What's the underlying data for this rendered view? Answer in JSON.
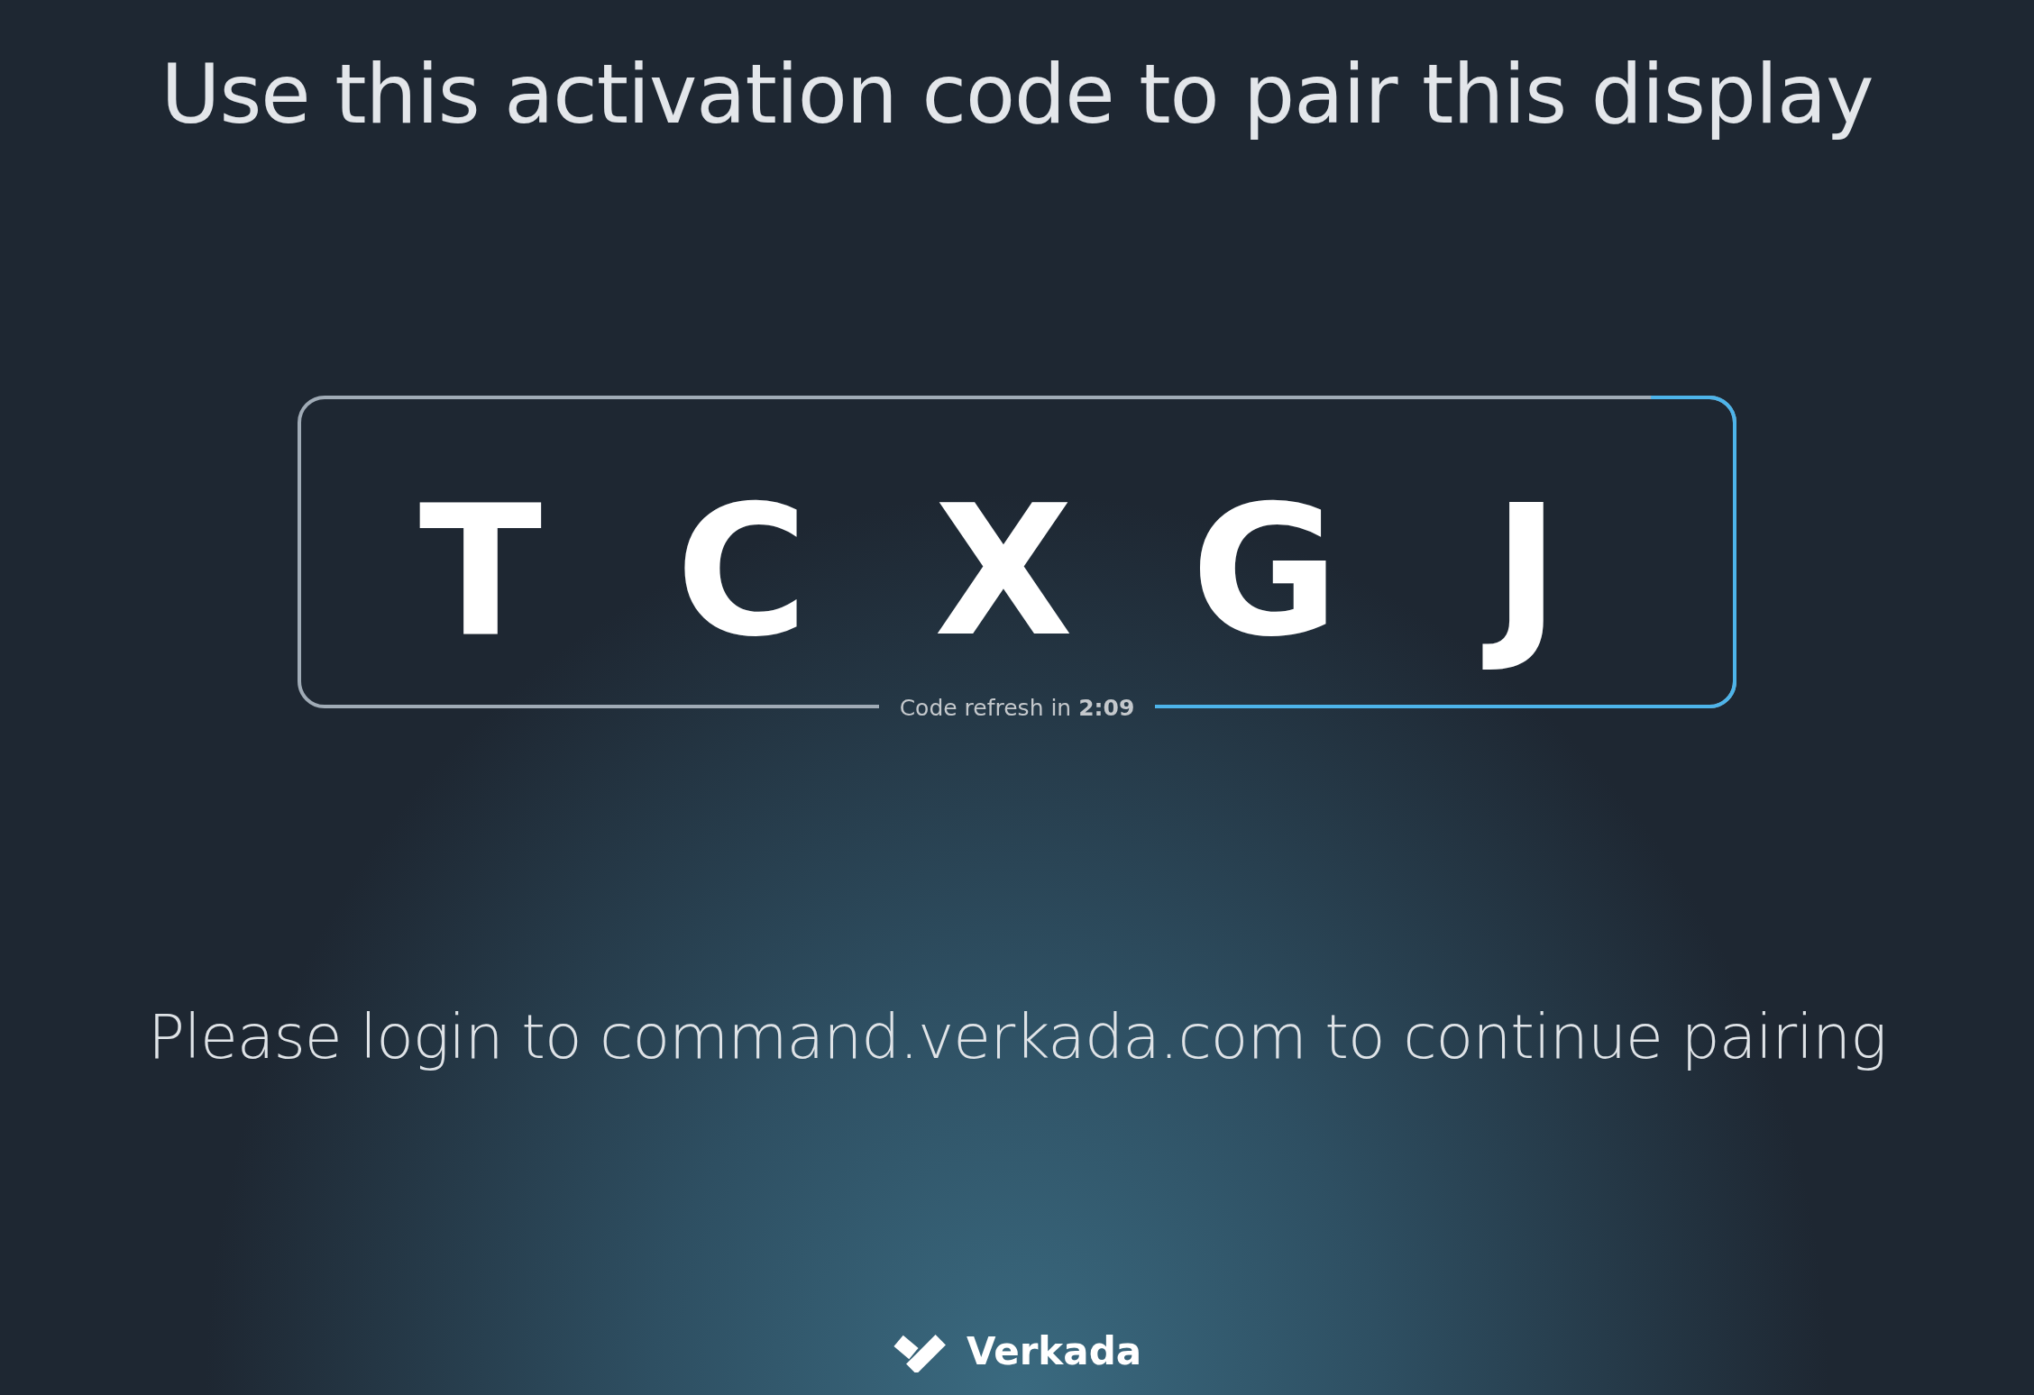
{
  "title": "Use this activation code to pair this display",
  "code": {
    "letters": [
      "T",
      "C",
      "X",
      "G",
      "J"
    ],
    "refresh": "Code refresh in **2:09**"
  },
  "message": "Please login to command.verkada.com to continue pairing",
  "brand": {
    "name": "Verkada"
  }
}
